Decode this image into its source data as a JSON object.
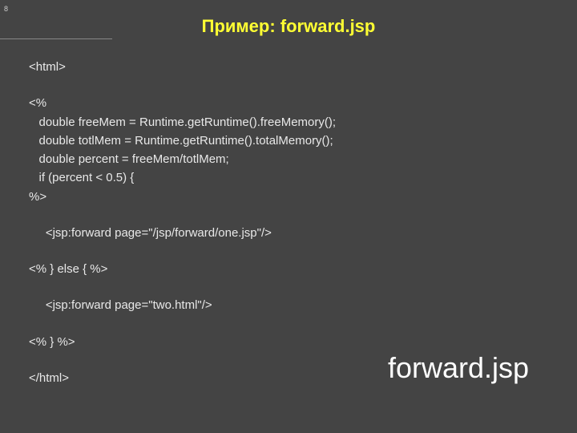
{
  "corner": "8",
  "title": "Пример: forward.jsp",
  "code": {
    "l1": "<html>",
    "l2": "<%",
    "l3": "   double freeMem = Runtime.getRuntime().freeMemory();",
    "l4": "   double totlMem = Runtime.getRuntime().totalMemory();",
    "l5": "   double percent = freeMem/totlMem;",
    "l6": "   if (percent < 0.5) {",
    "l7": "%>",
    "l8": "     <jsp:forward page=\"/jsp/forward/one.jsp\"/>",
    "l9": "<% } else { %>",
    "l10": "     <jsp:forward page=\"two.html\"/>",
    "l11": "<% } %>",
    "l12": "</html>"
  },
  "bigLabel": "forward.jsp"
}
